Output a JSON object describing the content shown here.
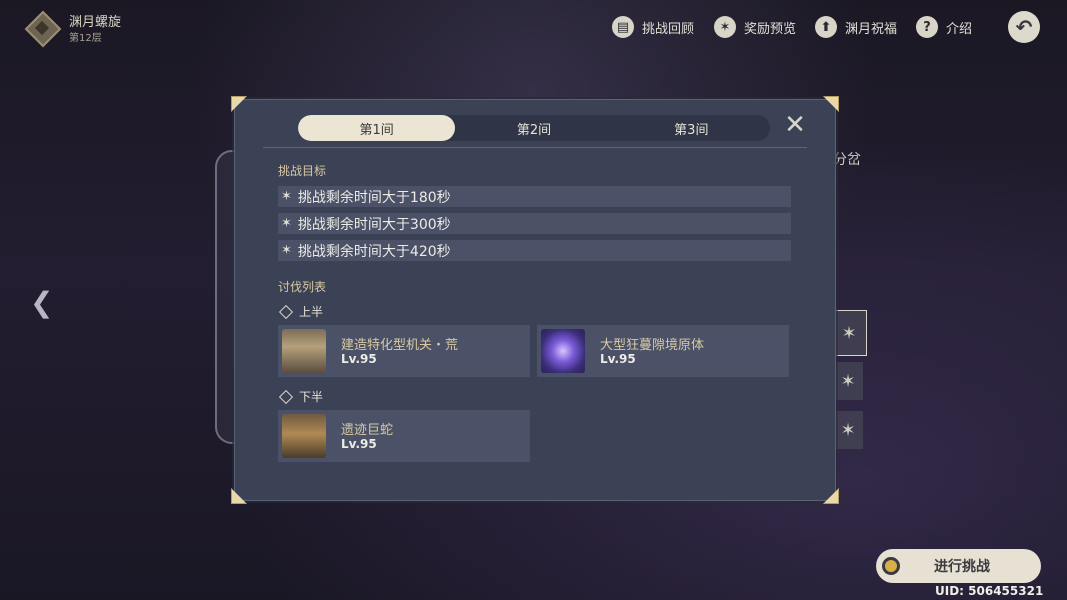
{
  "header": {
    "title": "渊月螺旋",
    "subtitle": "第12层"
  },
  "top_menu": {
    "challenge_review": "挑战回顾",
    "reward_preview": "奖励预览",
    "blessing": "渊月祝福",
    "intro": "介绍"
  },
  "background": {
    "side_label": "分岔"
  },
  "modal": {
    "tabs": [
      "第1间",
      "第2间",
      "第3间"
    ],
    "active_tab": "第1间",
    "objectives_title": "挑战目标",
    "objectives": [
      "挑战剩余时间大于180秒",
      "挑战剩余时间大于300秒",
      "挑战剩余时间大于420秒"
    ],
    "enemy_list_title": "讨伐列表",
    "first_half_label": "上半",
    "second_half_label": "下半",
    "first_half": [
      {
        "name": "建造特化型机关・荒",
        "level": "Lv.95"
      },
      {
        "name": "大型狂蔓隙境原体",
        "level": "Lv.95"
      }
    ],
    "second_half": [
      {
        "name": "遗迹巨蛇",
        "level": "Lv.95"
      }
    ]
  },
  "footer": {
    "start_button": "进行挑战",
    "uid": "UID: 506455321"
  },
  "colors": {
    "modal_bg": "#3b4255",
    "row_bg": "#4b5267",
    "accent_gold": "#d8c9a3",
    "active_tab": "#ece5d3"
  },
  "icons": [
    "book-icon",
    "star-badge-icon",
    "upgrade-icon",
    "help-icon",
    "back-icon",
    "close-icon",
    "left-arrow-icon"
  ]
}
